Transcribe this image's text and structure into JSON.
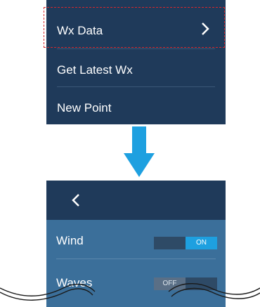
{
  "menu": {
    "items": [
      {
        "label": "Wx Data"
      },
      {
        "label": "Get Latest Wx"
      },
      {
        "label": "New Point"
      }
    ]
  },
  "panel": {
    "rows": [
      {
        "label": "Wind",
        "toggle": "ON"
      },
      {
        "label": "Waves",
        "toggle": "OFF"
      }
    ]
  },
  "icons": {
    "chevron": "chevron-right-icon",
    "back": "chevron-left-icon",
    "arrow": "down-arrow-icon"
  },
  "colors": {
    "menu_bg": "#1f3a5a",
    "panel_bg": "#3b6f9a",
    "accent": "#1ea0e0",
    "highlight": "#d6282c"
  }
}
